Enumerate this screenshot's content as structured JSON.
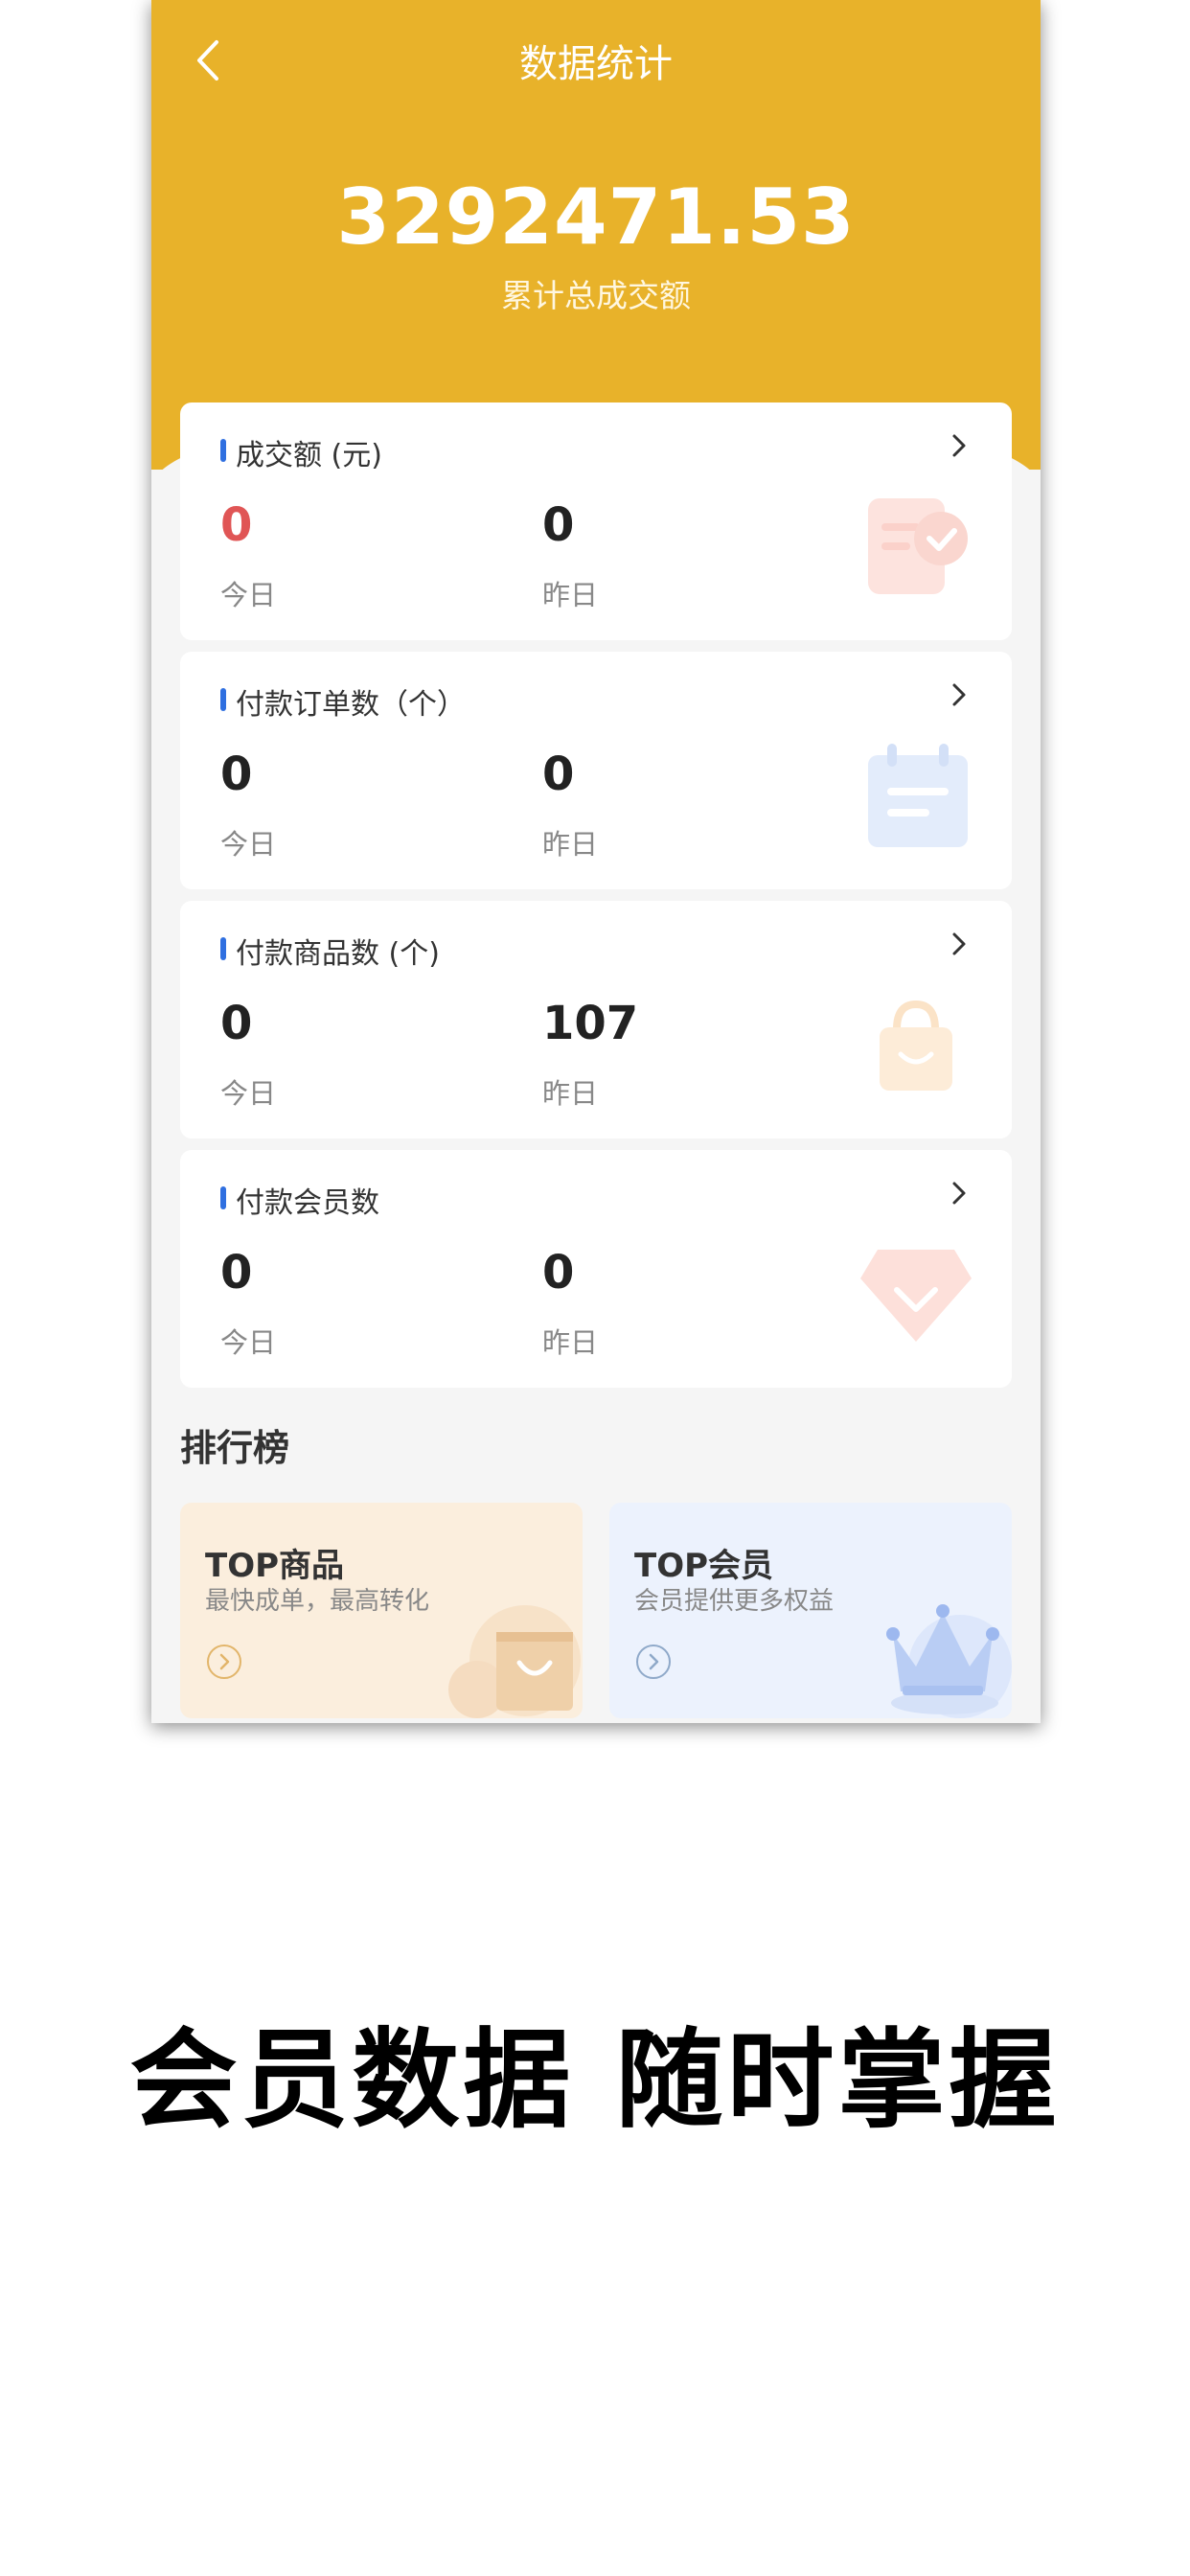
{
  "nav": {
    "title": "数据统计"
  },
  "summary": {
    "total": "3292471.53",
    "label": "累计总成交额"
  },
  "cards": [
    {
      "title": "成交额 (元)",
      "today_value": "0",
      "today_label": "今日",
      "yesterday_value": "0",
      "yesterday_label": "昨日",
      "icon": "receipt-check-icon"
    },
    {
      "title": "付款订单数（个）",
      "today_value": "0",
      "today_label": "今日",
      "yesterday_value": "0",
      "yesterday_label": "昨日",
      "icon": "notepad-icon"
    },
    {
      "title": "付款商品数 (个)",
      "today_value": "0",
      "today_label": "今日",
      "yesterday_value": "107",
      "yesterday_label": "昨日",
      "icon": "shopping-bag-icon"
    },
    {
      "title": "付款会员数",
      "today_value": "0",
      "today_label": "今日",
      "yesterday_value": "0",
      "yesterday_label": "昨日",
      "icon": "diamond-icon"
    }
  ],
  "ranking": {
    "title": "排行榜",
    "top_goods": {
      "title": "TOP商品",
      "subtitle": "最快成单，最高转化"
    },
    "top_members": {
      "title": "TOP会员",
      "subtitle": "会员提供更多权益"
    }
  },
  "slogan": "会员数据  随时掌握",
  "colors": {
    "header": "#e8b22a",
    "accent_bar": "#2f6fe0",
    "today_highlight": "#e05555"
  }
}
